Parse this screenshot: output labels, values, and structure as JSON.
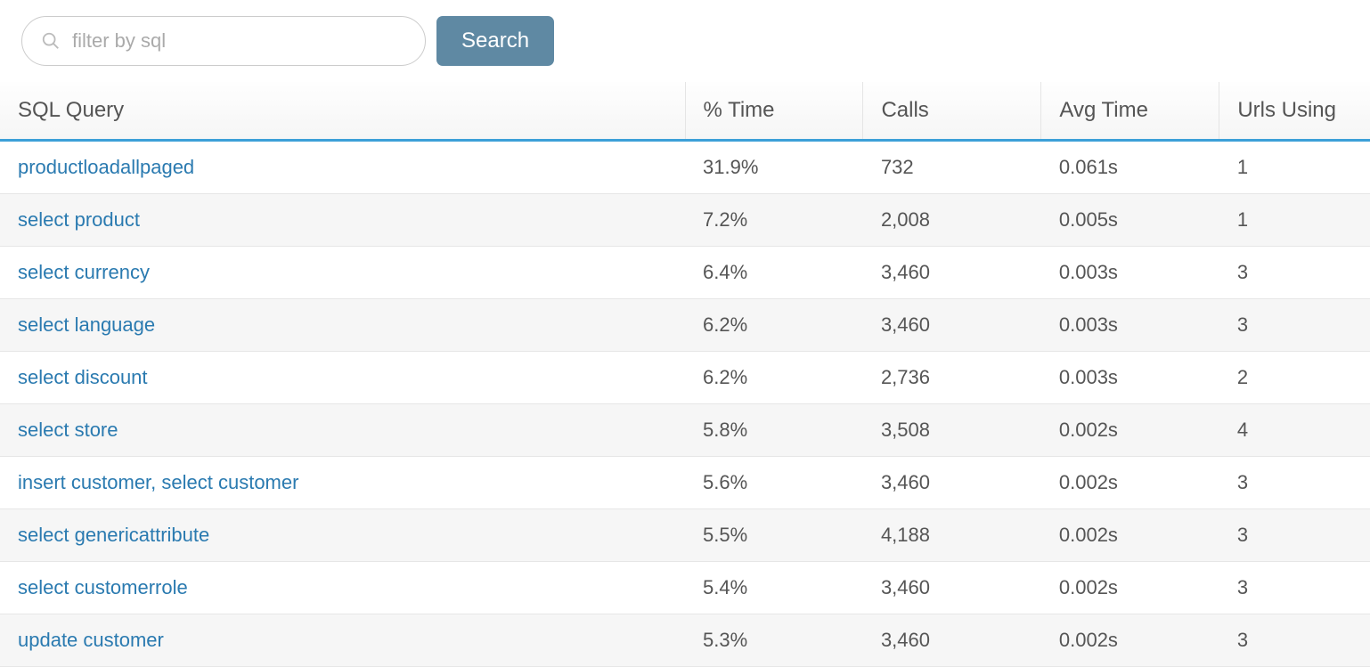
{
  "search": {
    "placeholder": "filter by sql",
    "button_label": "Search"
  },
  "columns": {
    "sql_query": "SQL Query",
    "pct_time": "% Time",
    "calls": "Calls",
    "avg_time": "Avg Time",
    "urls_using": "Urls Using"
  },
  "rows": [
    {
      "query": "productloadallpaged",
      "pct_time": "31.9%",
      "calls": "732",
      "avg_time": "0.061s",
      "urls_using": "1"
    },
    {
      "query": "select product",
      "pct_time": "7.2%",
      "calls": "2,008",
      "avg_time": "0.005s",
      "urls_using": "1"
    },
    {
      "query": "select currency",
      "pct_time": "6.4%",
      "calls": "3,460",
      "avg_time": "0.003s",
      "urls_using": "3"
    },
    {
      "query": "select language",
      "pct_time": "6.2%",
      "calls": "3,460",
      "avg_time": "0.003s",
      "urls_using": "3"
    },
    {
      "query": "select discount",
      "pct_time": "6.2%",
      "calls": "2,736",
      "avg_time": "0.003s",
      "urls_using": "2"
    },
    {
      "query": "select store",
      "pct_time": "5.8%",
      "calls": "3,508",
      "avg_time": "0.002s",
      "urls_using": "4"
    },
    {
      "query": "insert customer, select customer",
      "pct_time": "5.6%",
      "calls": "3,460",
      "avg_time": "0.002s",
      "urls_using": "3"
    },
    {
      "query": "select genericattribute",
      "pct_time": "5.5%",
      "calls": "4,188",
      "avg_time": "0.002s",
      "urls_using": "3"
    },
    {
      "query": "select customerrole",
      "pct_time": "5.4%",
      "calls": "3,460",
      "avg_time": "0.002s",
      "urls_using": "3"
    },
    {
      "query": "update customer",
      "pct_time": "5.3%",
      "calls": "3,460",
      "avg_time": "0.002s",
      "urls_using": "3"
    }
  ]
}
